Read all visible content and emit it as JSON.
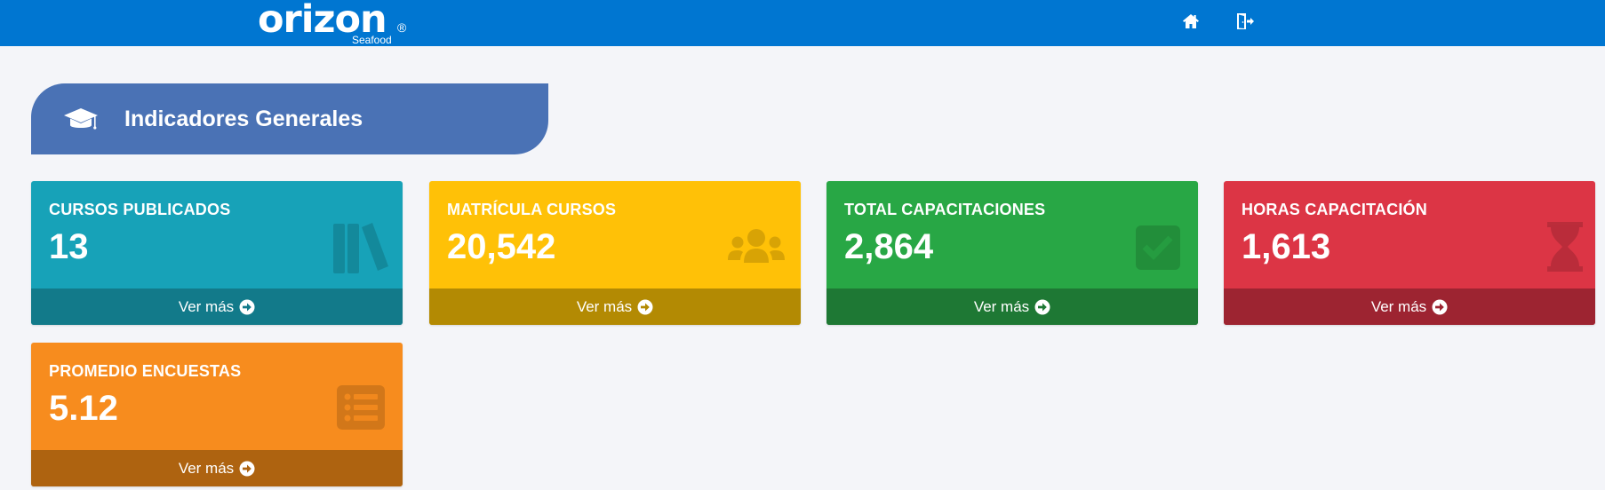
{
  "header": {
    "brand": "orizon",
    "brand_mark": "®",
    "brand_sub": "Seafood",
    "nav": [
      {
        "icon": "home-icon"
      },
      {
        "icon": "sign-out-icon"
      }
    ],
    "color": "#0076d1"
  },
  "section": {
    "title": "Indicadores Generales",
    "icon": "graduation-cap-icon",
    "color": "#4a72b5"
  },
  "cards": [
    {
      "title": "CURSOS PUBLICADOS",
      "value": "13",
      "link": "Ver más",
      "icon": "books-icon",
      "color": "#17a2b8"
    },
    {
      "title": "MATRÍCULA CURSOS",
      "value": "20,542",
      "link": "Ver más",
      "icon": "users-icon",
      "color": "#ffc107"
    },
    {
      "title": "TOTAL CAPACITACIONES",
      "value": "2,864",
      "link": "Ver más",
      "icon": "check-square-icon",
      "color": "#28a745"
    },
    {
      "title": "HORAS CAPACITACIÓN",
      "value": "1,613",
      "link": "Ver más",
      "icon": "hourglass-icon",
      "color": "#dc3545"
    },
    {
      "title": "PROMEDIO ENCUESTAS",
      "value": "5.12",
      "link": "Ver más",
      "icon": "list-icon",
      "color": "#f78c1e"
    }
  ]
}
